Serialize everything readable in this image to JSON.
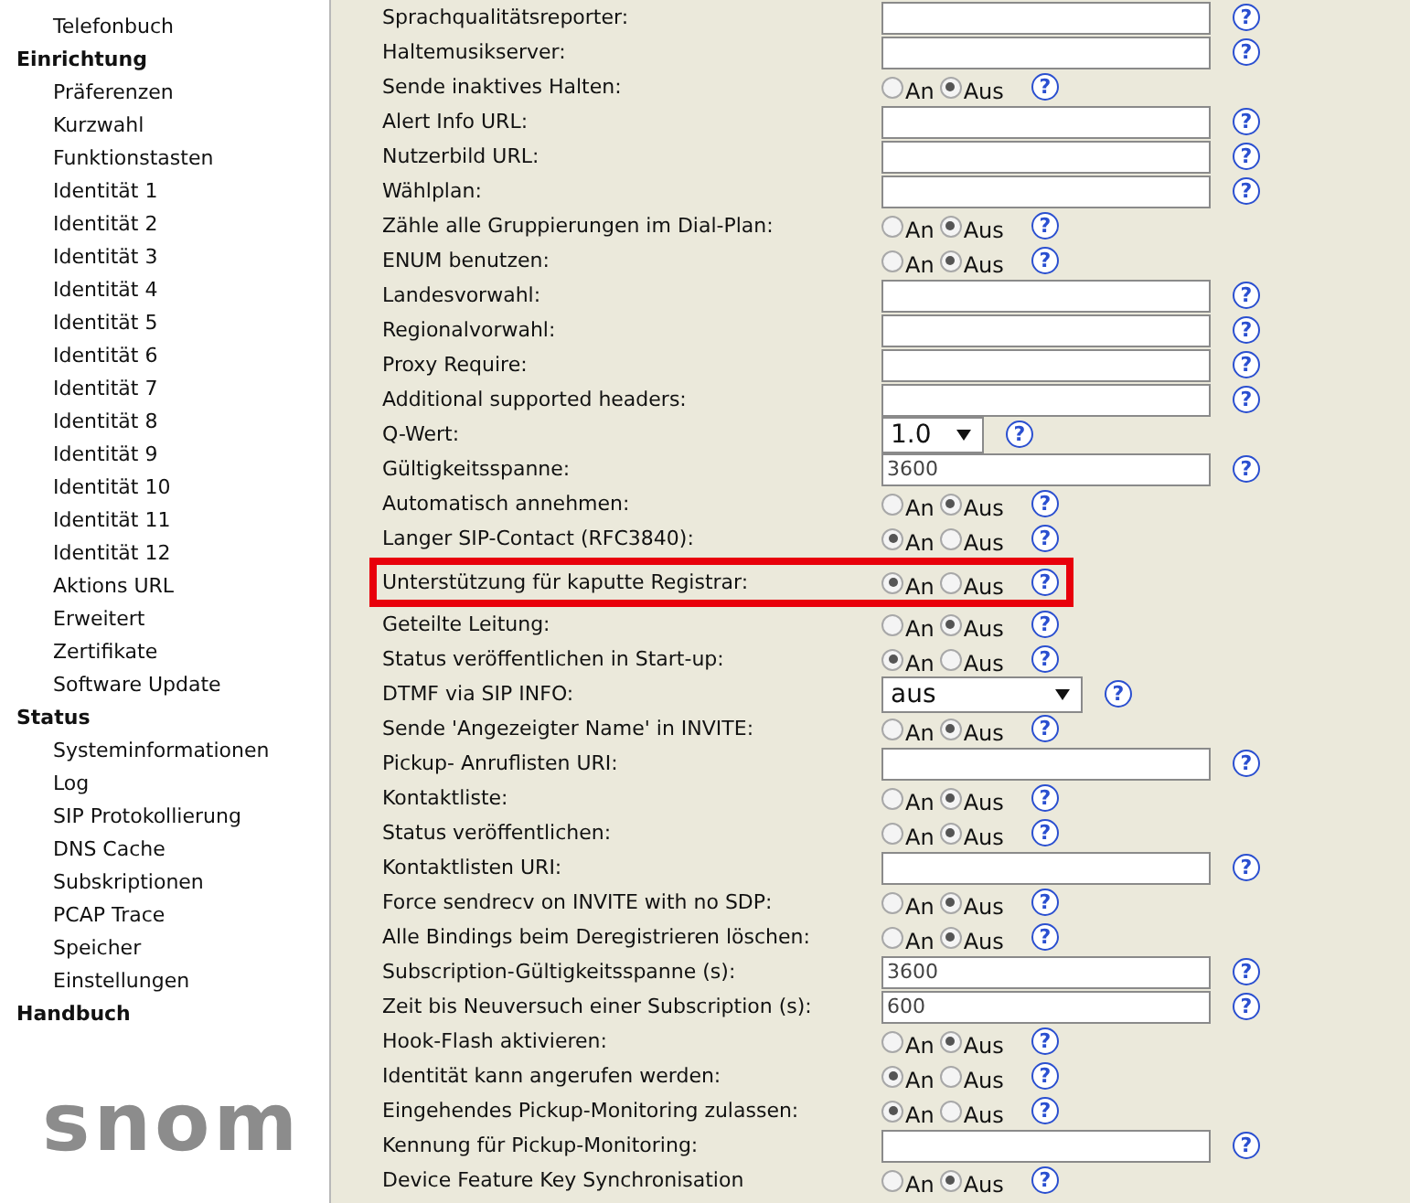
{
  "sidebar": {
    "items": [
      {
        "kind": "link",
        "label": "Telefonbuch"
      },
      {
        "kind": "section",
        "label": "Einrichtung"
      },
      {
        "kind": "link",
        "label": "Präferenzen"
      },
      {
        "kind": "link",
        "label": "Kurzwahl"
      },
      {
        "kind": "link",
        "label": "Funktionstasten"
      },
      {
        "kind": "link",
        "label": "Identität 1"
      },
      {
        "kind": "link",
        "label": "Identität 2"
      },
      {
        "kind": "link",
        "label": "Identität 3"
      },
      {
        "kind": "link",
        "label": "Identität 4"
      },
      {
        "kind": "link",
        "label": "Identität 5"
      },
      {
        "kind": "link",
        "label": "Identität 6"
      },
      {
        "kind": "link",
        "label": "Identität 7"
      },
      {
        "kind": "link",
        "label": "Identität 8"
      },
      {
        "kind": "link",
        "label": "Identität 9"
      },
      {
        "kind": "link",
        "label": "Identität 10"
      },
      {
        "kind": "link",
        "label": "Identität 11"
      },
      {
        "kind": "link",
        "label": "Identität 12"
      },
      {
        "kind": "link",
        "label": "Aktions URL"
      },
      {
        "kind": "link",
        "label": "Erweitert"
      },
      {
        "kind": "link",
        "label": "Zertifikate"
      },
      {
        "kind": "link",
        "label": "Software Update"
      },
      {
        "kind": "section",
        "label": "Status"
      },
      {
        "kind": "link",
        "label": "Systeminformationen"
      },
      {
        "kind": "link",
        "label": "Log"
      },
      {
        "kind": "link",
        "label": "SIP Protokollierung"
      },
      {
        "kind": "link",
        "label": "DNS Cache"
      },
      {
        "kind": "link",
        "label": "Subskriptionen"
      },
      {
        "kind": "link",
        "label": "PCAP Trace"
      },
      {
        "kind": "link",
        "label": "Speicher"
      },
      {
        "kind": "link",
        "label": "Einstellungen"
      },
      {
        "kind": "section",
        "label": "Handbuch"
      }
    ],
    "logo": "snom"
  },
  "rows": [
    {
      "label": "Sprachqualitätsreporter:",
      "kind": "text",
      "help": "?"
    },
    {
      "label": "Haltemusikserver:",
      "kind": "text",
      "help": "?"
    },
    {
      "label": "Sende inaktives Halten:",
      "kind": "radio",
      "options": [
        {
          "label": "An",
          "selected": false
        },
        {
          "label": "Aus",
          "selected": true
        }
      ],
      "help": "?"
    },
    {
      "label": "Alert Info URL:",
      "kind": "text",
      "help": "?"
    },
    {
      "label": "Nutzerbild URL:",
      "kind": "text",
      "help": "?"
    },
    {
      "label": "Wählplan:",
      "kind": "text",
      "help": "?"
    },
    {
      "label": "Zähle alle Gruppierungen im Dial-Plan:",
      "kind": "radio",
      "options": [
        {
          "label": "An",
          "selected": false
        },
        {
          "label": "Aus",
          "selected": true
        }
      ],
      "help": "?"
    },
    {
      "label": "ENUM benutzen:",
      "kind": "radio",
      "options": [
        {
          "label": "An",
          "selected": false
        },
        {
          "label": "Aus",
          "selected": true
        }
      ],
      "help": "?"
    },
    {
      "label": "Landesvorwahl:",
      "kind": "text",
      "help": "?"
    },
    {
      "label": "Regionalvorwahl:",
      "kind": "text",
      "help": "?"
    },
    {
      "label": "Proxy Require:",
      "kind": "text",
      "help": "?"
    },
    {
      "label": "Additional supported headers:",
      "kind": "text",
      "help": "?"
    },
    {
      "label": "Q-Wert:",
      "kind": "select",
      "value": "1.0",
      "help": "?"
    },
    {
      "label": "Gültigkeitsspanne:",
      "kind": "text",
      "value": "3600",
      "help": "?"
    },
    {
      "label": "Automatisch annehmen:",
      "kind": "radio",
      "options": [
        {
          "label": "An",
          "selected": false
        },
        {
          "label": "Aus",
          "selected": true
        }
      ],
      "help": "?"
    },
    {
      "label": "Langer SIP-Contact (RFC3840):",
      "kind": "radio",
      "options": [
        {
          "label": "An",
          "selected": true
        },
        {
          "label": "Aus",
          "selected": false
        }
      ],
      "help": "?"
    },
    {
      "label": "Unterstützung für kaputte Registrar:",
      "kind": "radio",
      "highlighted": true,
      "options": [
        {
          "label": "An",
          "selected": true
        },
        {
          "label": "Aus",
          "selected": false
        }
      ],
      "help": "?"
    },
    {
      "label": "Geteilte Leitung:",
      "kind": "radio",
      "options": [
        {
          "label": "An",
          "selected": false
        },
        {
          "label": "Aus",
          "selected": true
        }
      ],
      "help": "?"
    },
    {
      "label": "Status veröffentlichen in Start-up:",
      "kind": "radio",
      "options": [
        {
          "label": "An",
          "selected": true
        },
        {
          "label": "Aus",
          "selected": false
        }
      ],
      "help": "?"
    },
    {
      "label": "DTMF via SIP INFO:",
      "kind": "select",
      "wide": true,
      "value": "aus",
      "help": "?"
    },
    {
      "label": "Sende 'Angezeigter Name' in INVITE:",
      "kind": "radio",
      "options": [
        {
          "label": "An",
          "selected": false
        },
        {
          "label": "Aus",
          "selected": true
        }
      ],
      "help": "?"
    },
    {
      "label": "Pickup- Anruflisten URI:",
      "kind": "text",
      "help": "?"
    },
    {
      "label": "Kontaktliste:",
      "kind": "radio",
      "options": [
        {
          "label": "An",
          "selected": false
        },
        {
          "label": "Aus",
          "selected": true
        }
      ],
      "help": "?"
    },
    {
      "label": "Status veröffentlichen:",
      "kind": "radio",
      "options": [
        {
          "label": "An",
          "selected": false
        },
        {
          "label": "Aus",
          "selected": true
        }
      ],
      "help": "?"
    },
    {
      "label": "Kontaktlisten URI:",
      "kind": "text",
      "help": "?"
    },
    {
      "label": "Force sendrecv on INVITE with no SDP:",
      "kind": "radio",
      "options": [
        {
          "label": "An",
          "selected": false
        },
        {
          "label": "Aus",
          "selected": true
        }
      ],
      "help": "?"
    },
    {
      "label": "Alle Bindings beim Deregistrieren löschen:",
      "kind": "radio",
      "options": [
        {
          "label": "An",
          "selected": false
        },
        {
          "label": "Aus",
          "selected": true
        }
      ],
      "help": "?"
    },
    {
      "label": "Subscription-Gültigkeitsspanne (s):",
      "kind": "text",
      "value": "3600",
      "help": "?"
    },
    {
      "label": "Zeit bis Neuversuch einer Subscription (s):",
      "kind": "text",
      "value": "600",
      "help": "?"
    },
    {
      "label": "Hook-Flash aktivieren:",
      "kind": "radio",
      "options": [
        {
          "label": "An",
          "selected": false
        },
        {
          "label": "Aus",
          "selected": true
        }
      ],
      "help": "?"
    },
    {
      "label": "Identität kann angerufen werden:",
      "kind": "radio",
      "options": [
        {
          "label": "An",
          "selected": true
        },
        {
          "label": "Aus",
          "selected": false
        }
      ],
      "help": "?"
    },
    {
      "label": "Eingehendes Pickup-Monitoring zulassen:",
      "kind": "radio",
      "options": [
        {
          "label": "An",
          "selected": true
        },
        {
          "label": "Aus",
          "selected": false
        }
      ],
      "help": "?"
    },
    {
      "label": "Kennung für Pickup-Monitoring:",
      "kind": "text",
      "help": "?"
    },
    {
      "label": "Device Feature Key Synchronisation",
      "kind": "radio",
      "options": [
        {
          "label": "An",
          "selected": false
        },
        {
          "label": "Aus",
          "selected": true
        }
      ],
      "help": "?"
    }
  ]
}
